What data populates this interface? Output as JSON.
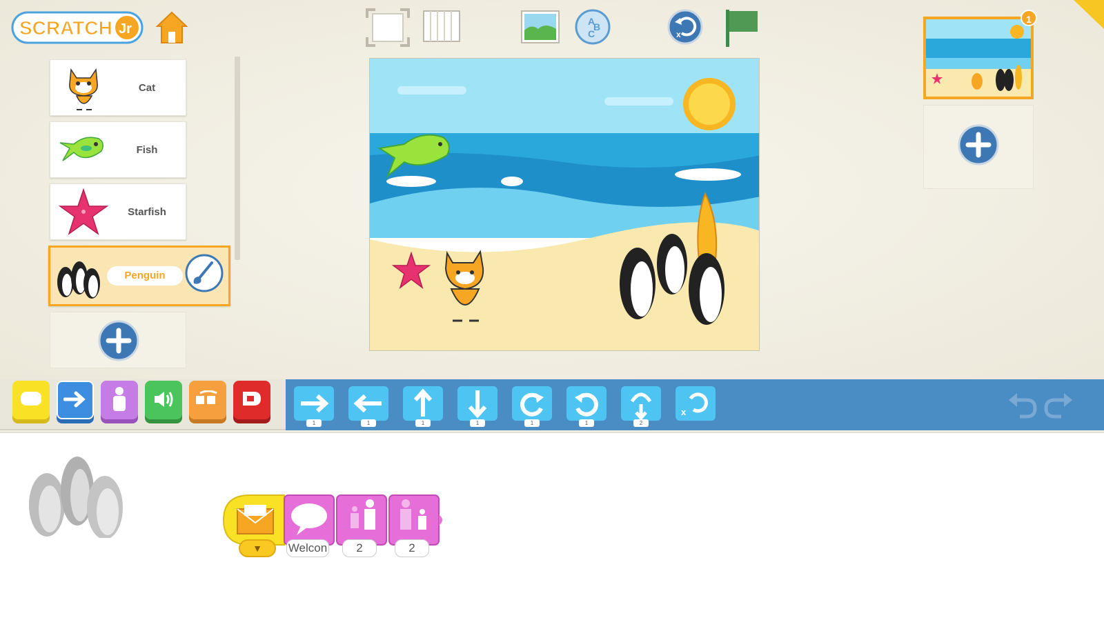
{
  "app": {
    "logo_text": "ScratchJr"
  },
  "toolbar": {
    "home": "home-icon",
    "fullscreen": "fullscreen-icon",
    "grid": "grid-icon",
    "background": "background-icon",
    "text": "text-icon",
    "reset": "reset-icon",
    "green_flag": "green-flag-icon"
  },
  "sprites": [
    {
      "name": "Cat"
    },
    {
      "name": "Fish"
    },
    {
      "name": "Starfish"
    },
    {
      "name": "Penguin"
    }
  ],
  "pages": {
    "badge": "1"
  },
  "palette": {
    "categories": [
      "Triggering",
      "Motion",
      "Looks",
      "Sound",
      "Control",
      "End"
    ],
    "active_category": "Motion",
    "blocks": [
      {
        "name": "move-right",
        "value": "1"
      },
      {
        "name": "move-left",
        "value": "1"
      },
      {
        "name": "move-up",
        "value": "1"
      },
      {
        "name": "move-down",
        "value": "1"
      },
      {
        "name": "turn-right",
        "value": "1"
      },
      {
        "name": "turn-left",
        "value": "1"
      },
      {
        "name": "hop",
        "value": "2"
      },
      {
        "name": "go-home",
        "value": ""
      }
    ]
  },
  "script": {
    "trigger_dropdown": "▼",
    "say_text": "Welcon",
    "grow_value": "2",
    "shrink_value": "2"
  },
  "colors": {
    "accent": "#f6a623",
    "palette_blue": "#4a8cc4",
    "looks_pink": "#e16ee6",
    "trigger_yellow": "#f9e126"
  }
}
